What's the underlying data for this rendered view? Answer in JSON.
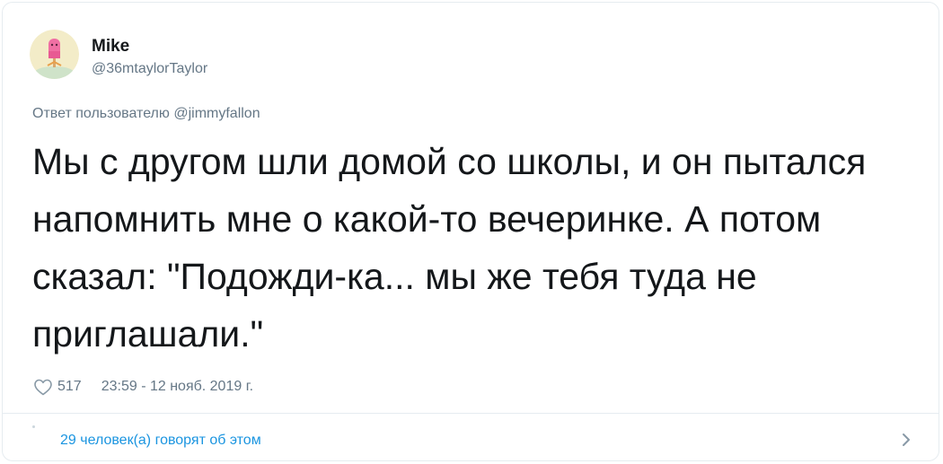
{
  "user": {
    "display_name": "Mike",
    "handle": "@36mtaylorTaylor",
    "avatar_icon": "popsicle-avatar-icon"
  },
  "reply_to": {
    "prefix": "Ответ пользователю",
    "mention": "@jimmyfallon"
  },
  "tweet": {
    "text": "Мы с другом шли домой со школы, и он пытался напомнить мне о какой-то вечеринке. А потом сказал: \"Подожди-ка... мы же тебя туда не приглашали.\"",
    "likes": "517",
    "timestamp": "23:59 - 12 нояб. 2019 г."
  },
  "footer": {
    "conversation_link": "29 человек(а) говорят об этом"
  },
  "colors": {
    "text": "#14171a",
    "secondary": "#657786",
    "link": "#1b95e0",
    "border": "#e6ecf0"
  }
}
